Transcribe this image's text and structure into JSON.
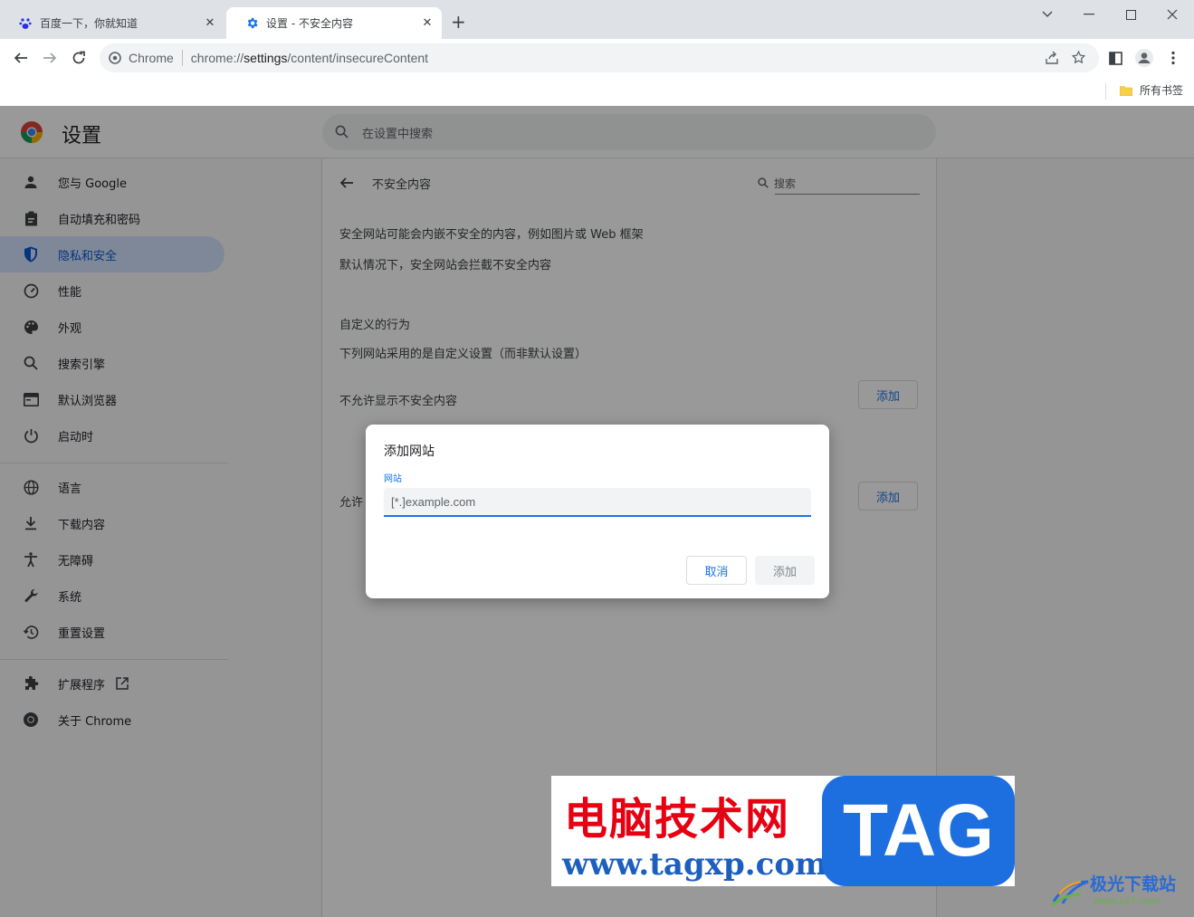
{
  "browser": {
    "tabs": [
      {
        "title": "百度一下，你就知道",
        "favicon": "baidu-paw-icon",
        "active": false
      },
      {
        "title": "设置 - 不安全内容",
        "favicon": "settings-gear-icon",
        "active": true
      }
    ],
    "address_scheme_label": "Chrome",
    "address_url_prefix": "chrome://",
    "address_url_path": "settings",
    "address_url_rest": "/content/insecureContent",
    "bookmarks_all": "所有书签"
  },
  "settings": {
    "title": "设置",
    "search_placeholder": "在设置中搜索",
    "nav": [
      {
        "label": "您与 Google",
        "icon": "person-icon"
      },
      {
        "label": "自动填充和密码",
        "icon": "clipboard-icon"
      },
      {
        "label": "隐私和安全",
        "icon": "shield-icon",
        "active": true
      },
      {
        "label": "性能",
        "icon": "speedometer-icon"
      },
      {
        "label": "外观",
        "icon": "palette-icon"
      },
      {
        "label": "搜索引擎",
        "icon": "search-icon"
      },
      {
        "label": "默认浏览器",
        "icon": "browser-window-icon"
      },
      {
        "label": "启动时",
        "icon": "power-icon"
      },
      {
        "label": "语言",
        "icon": "globe-icon"
      },
      {
        "label": "下载内容",
        "icon": "download-icon"
      },
      {
        "label": "无障碍",
        "icon": "accessibility-icon"
      },
      {
        "label": "系统",
        "icon": "wrench-icon"
      },
      {
        "label": "重置设置",
        "icon": "history-icon"
      },
      {
        "label": "扩展程序",
        "icon": "puzzle-icon"
      },
      {
        "label": "关于 Chrome",
        "icon": "chrome-icon"
      }
    ]
  },
  "content": {
    "page_title": "不安全内容",
    "search_placeholder": "搜索",
    "desc1": "安全网站可能会内嵌不安全的内容，例如图片或 Web 框架",
    "desc2": "默认情况下，安全网站会拦截不安全内容",
    "custom_heading": "自定义的行为",
    "custom_desc": "下列网站采用的是自定义设置（而非默认设置）",
    "block_label": "不允许显示不安全内容",
    "allow_label_partial": "允许",
    "add_label": "添加"
  },
  "dialog": {
    "title": "添加网站",
    "field_label": "网站",
    "input_placeholder": "[*.]example.com",
    "cancel_label": "取消",
    "add_label": "添加"
  },
  "watermark": {
    "cn_text": "电脑技术网",
    "url": "www.tagxp.com",
    "tag": "TAG",
    "site2_text": "极光下载站",
    "site2_url": "www.xz7.com"
  },
  "colors": {
    "accent": "#1a73e8",
    "active_nav_bg": "#d3e3fd",
    "watermark_red": "#e60012",
    "watermark_blue": "#1d6fe0"
  }
}
